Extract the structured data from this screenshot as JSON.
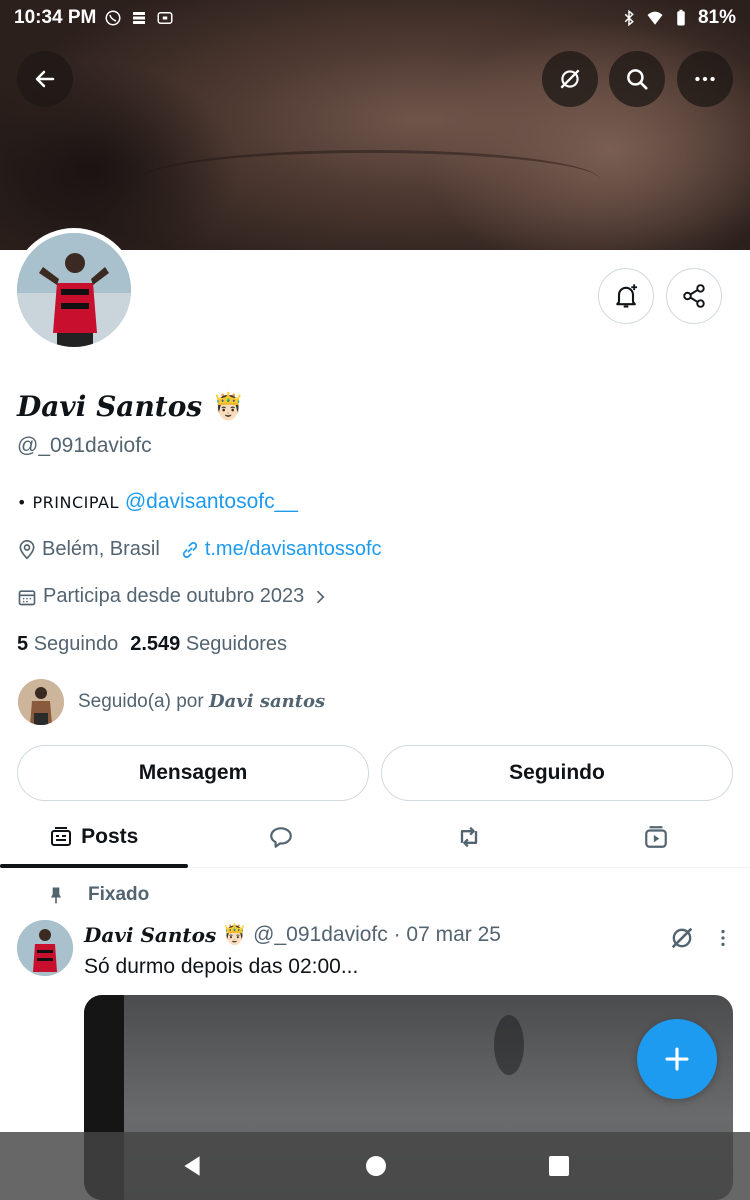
{
  "status_bar": {
    "time": "10:34 PM",
    "battery": "81%"
  },
  "profile": {
    "name": "Davi Santos",
    "name_emoji": "🤴🏻",
    "handle": "@_091daviofc",
    "bio_prefix": "• PRINCIPAL",
    "bio_link": "@davisantosofc__",
    "location": "Belém, Brasil",
    "website": "t.me/davisantossofc",
    "joined": "Participa desde outubro 2023",
    "following_count": "5",
    "following_label": "Seguindo",
    "followers_count": "2.549",
    "followers_label": "Seguidores",
    "followed_by_prefix": "Seguido(a) por",
    "followed_by_name": "Davi santos"
  },
  "actions": {
    "message": "Mensagem",
    "following": "Seguindo"
  },
  "tabs": [
    {
      "label": "Posts",
      "icon": "posts-icon",
      "active": true
    },
    {
      "label": "",
      "icon": "replies-icon"
    },
    {
      "label": "",
      "icon": "reposts-icon"
    },
    {
      "label": "",
      "icon": "media-icon"
    }
  ],
  "pinned_post": {
    "pinned_label": "Fixado",
    "author": "Davi Santos",
    "author_emoji": "🤴🏻",
    "handle_date": "@_091daviofc · 07 mar 25",
    "text": "Só durmo depois das 02:00..."
  },
  "colors": {
    "accent": "#1d9bf0",
    "text": "#0f1419",
    "muted": "#536471"
  }
}
